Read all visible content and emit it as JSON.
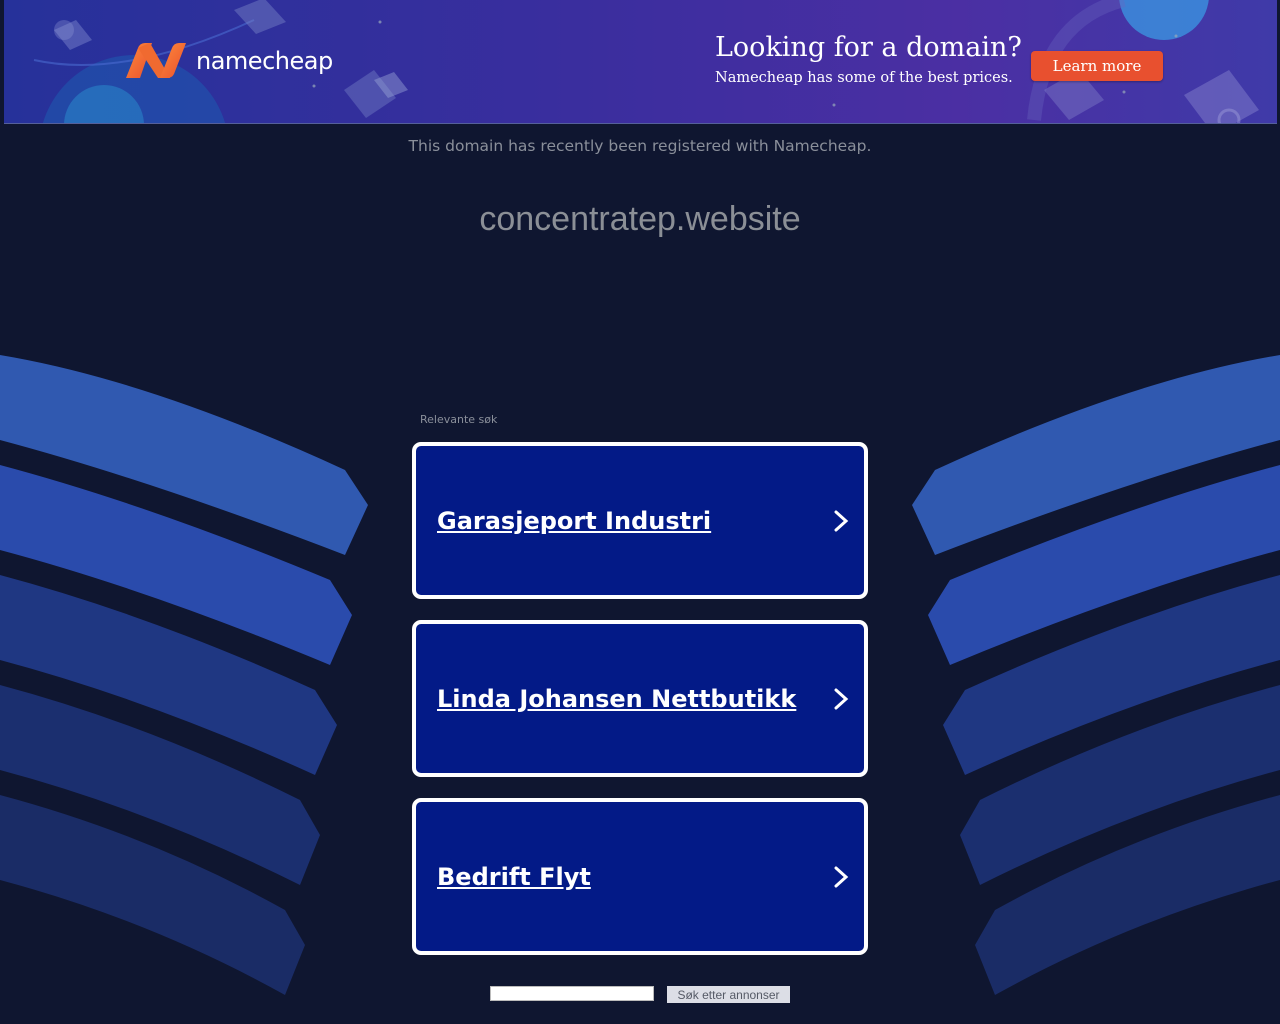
{
  "banner": {
    "brand": "namecheap",
    "headline": "Looking for a domain?",
    "subline": "Namecheap has some of the best prices.",
    "cta_label": "Learn more",
    "accent_color": "#e8502f",
    "logo_icon": "namecheap-n-logo"
  },
  "main": {
    "registered_notice": "This domain has recently been registered with Namecheap.",
    "domain_name": "concentratep.website",
    "related_label": "Relevante søk",
    "links": [
      {
        "label": "Garasjeport Industri",
        "icon": "chevron-right-icon"
      },
      {
        "label": "Linda Johansen Nettbutikk",
        "icon": "chevron-right-icon"
      },
      {
        "label": "Bedrift Flyt",
        "icon": "chevron-right-icon"
      }
    ],
    "card_color": "#031a87"
  },
  "search": {
    "input_value": "",
    "button_label": "Søk etter annonser"
  }
}
